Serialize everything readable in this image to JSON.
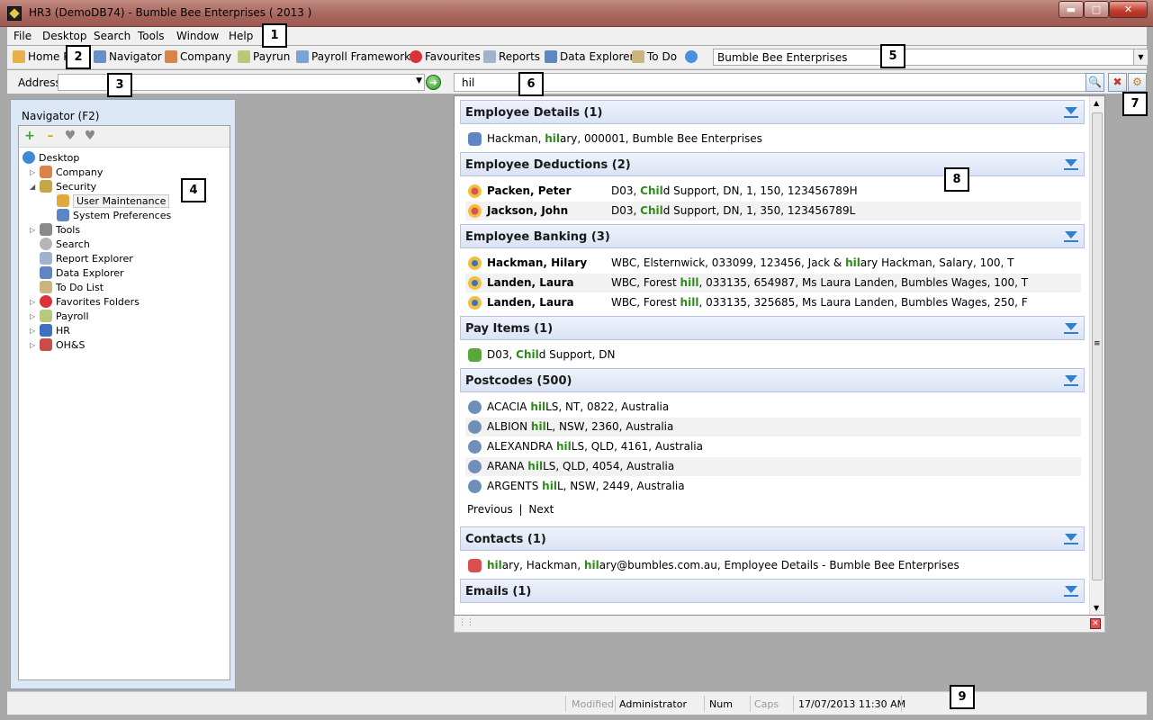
{
  "window": {
    "title": "HR3  (DemoDB74) - Bumble Bee Enterprises ( 2013 )"
  },
  "menu": [
    "File",
    "Desktop",
    "Search",
    "Tools",
    "Window",
    "Help"
  ],
  "toolbar": {
    "items": [
      "Home P",
      "Navigator",
      "Company",
      "Payrun",
      "Payroll Framework",
      "Favourites",
      "Reports",
      "Data Explorer",
      "To Do"
    ],
    "company": "Bumble Bee Enterprises"
  },
  "address": {
    "label": "Address",
    "value": ""
  },
  "search": {
    "value": "hil"
  },
  "navigator": {
    "title": "Navigator (F2)",
    "tree": [
      "Desktop",
      "Company",
      "Security",
      "User Maintenance",
      "System Preferences",
      "Tools",
      "Search",
      "Report Explorer",
      "Data Explorer",
      "To Do List",
      "Favorites Folders",
      "Payroll",
      "HR",
      "OH&S"
    ]
  },
  "results": {
    "sections": {
      "employee_details": "Employee Details (1)",
      "employee_deductions": "Employee Deductions (2)",
      "employee_banking": "Employee Banking (3)",
      "pay_items": "Pay Items (1)",
      "postcodes": "Postcodes (500)",
      "contacts": "Contacts (1)",
      "emails": "Emails (1)"
    },
    "details": {
      "pre": "Hackman, ",
      "hl": "hil",
      "post": "ary, 000001, Bumble Bee Enterprises"
    },
    "deductions": [
      {
        "name": "Packen, Peter",
        "pre": "D03, ",
        "hl": "Chil",
        "post": "d Support, DN, 1, 150, 123456789H"
      },
      {
        "name": "Jackson, John",
        "pre": "D03, ",
        "hl": "Chil",
        "post": "d Support, DN, 1, 350, 123456789L"
      }
    ],
    "banking": [
      {
        "name": "Hackman, Hilary",
        "pre": "WBC, Elsternwick, 033099, 123456, Jack & ",
        "hl": "hil",
        "post": "ary Hackman, Salary, 100, T"
      },
      {
        "name": "Landen, Laura",
        "pre": "WBC, Forest ",
        "hl": "hill",
        "post": ", 033135, 654987, Ms Laura Landen, Bumbles Wages, 100, T"
      },
      {
        "name": "Landen, Laura",
        "pre": "WBC, Forest ",
        "hl": "hill",
        "post": ", 033135, 325685, Ms Laura Landen, Bumbles Wages, 250, F"
      }
    ],
    "pay_item": {
      "pre": "D03, ",
      "hl": "Chil",
      "post": "d Support, DN"
    },
    "postcodes": [
      {
        "pre": "ACACIA ",
        "hl": "hil",
        "post": "LS, NT, 0822, Australia"
      },
      {
        "pre": "ALBION ",
        "hl": "hil",
        "post": "L, NSW, 2360, Australia"
      },
      {
        "pre": "ALEXANDRA ",
        "hl": "hil",
        "post": "LS, QLD, 4161, Australia"
      },
      {
        "pre": "ARANA ",
        "hl": "hil",
        "post": "LS, QLD, 4054, Australia"
      },
      {
        "pre": "ARGENTS ",
        "hl": "hil",
        "post": "L, NSW, 2449, Australia"
      }
    ],
    "pager": {
      "previous": "Previous",
      "sep": "|",
      "next": "Next"
    },
    "contact": {
      "hl1": "hil",
      "mid1": "ary, Hackman, ",
      "hl2": "hil",
      "post": "ary@bumbles.com.au, Employee Details - Bumble Bee Enterprises"
    }
  },
  "statusbar": {
    "modified": "Modified",
    "user": "Administrator",
    "num": "Num",
    "caps": "Caps",
    "datetime": "17/07/2013 11:30 AM"
  },
  "callouts": [
    "1",
    "2",
    "3",
    "4",
    "5",
    "6",
    "7",
    "8",
    "9"
  ]
}
